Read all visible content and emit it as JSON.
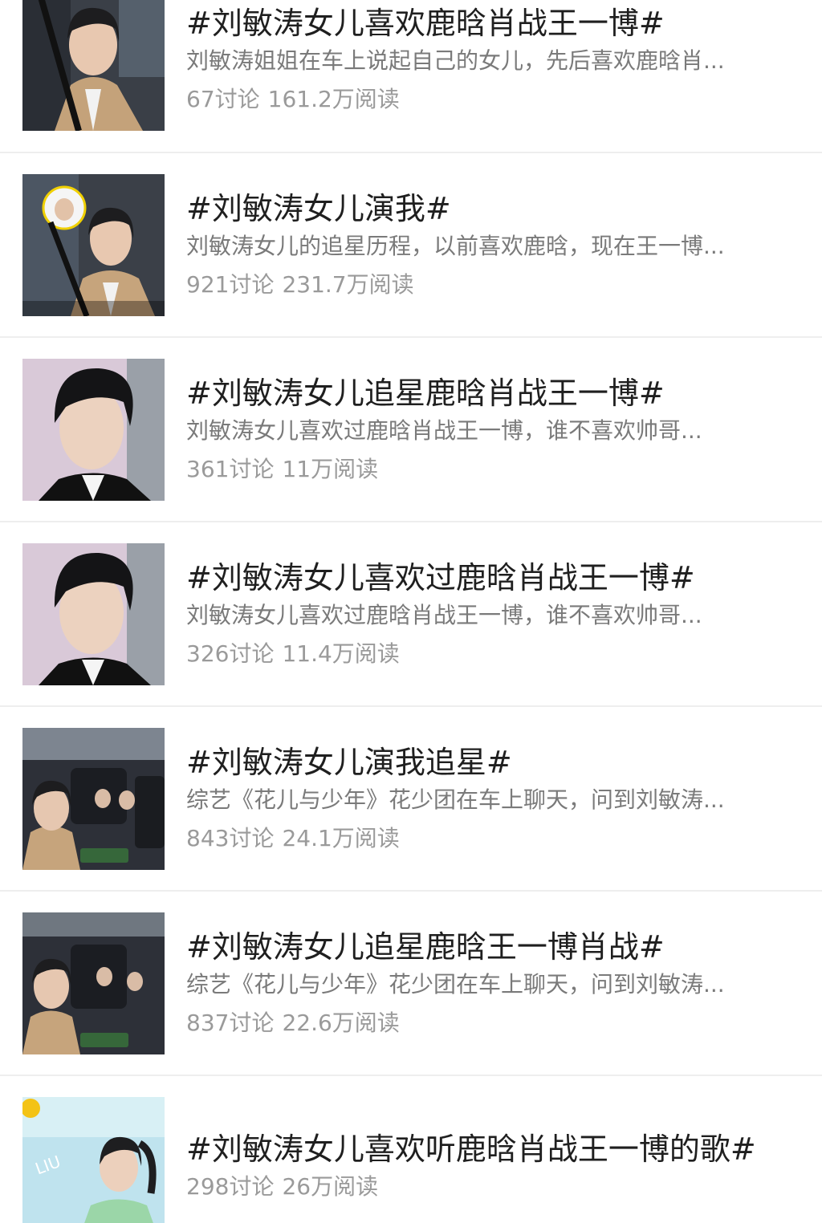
{
  "topics": [
    {
      "title": "#刘敏涛女儿喜欢鹿晗肖战王一博#",
      "description": "刘敏涛姐姐在车上说起自己的女儿，先后喜欢鹿晗肖...",
      "discussions": "67讨论",
      "reads": "161.2万阅读",
      "thumbnail_icon": "woman-in-car-thumbnail"
    },
    {
      "title": "#刘敏涛女儿演我#",
      "description": "刘敏涛女儿的追星历程，以前喜欢鹿晗，现在王一博...",
      "discussions": "921讨论",
      "reads": "231.7万阅读",
      "thumbnail_icon": "woman-in-car-thumbnail"
    },
    {
      "title": "#刘敏涛女儿追星鹿晗肖战王一博#",
      "description": "刘敏涛女儿喜欢过鹿晗肖战王一博，谁不喜欢帅哥...",
      "discussions": "361讨论",
      "reads": "11万阅读",
      "thumbnail_icon": "man-portrait-thumbnail"
    },
    {
      "title": "#刘敏涛女儿喜欢过鹿晗肖战王一博#",
      "description": "刘敏涛女儿喜欢过鹿晗肖战王一博，谁不喜欢帅哥...",
      "discussions": "326讨论",
      "reads": "11.4万阅读",
      "thumbnail_icon": "man-portrait-thumbnail"
    },
    {
      "title": "#刘敏涛女儿演我追星#",
      "description": "综艺《花儿与少年》花少团在车上聊天，问到刘敏涛...",
      "discussions": "843讨论",
      "reads": "24.1万阅读",
      "thumbnail_icon": "group-in-car-thumbnail"
    },
    {
      "title": "#刘敏涛女儿追星鹿晗王一博肖战#",
      "description": "综艺《花儿与少年》花少团在车上聊天，问到刘敏涛...",
      "discussions": "837讨论",
      "reads": "22.6万阅读",
      "thumbnail_icon": "group-in-car-thumbnail"
    },
    {
      "title": "#刘敏涛女儿喜欢听鹿晗肖战王一博的歌#",
      "description": "",
      "discussions": "298讨论",
      "reads": "26万阅读",
      "thumbnail_icon": "woman-green-sweater-thumbnail"
    }
  ]
}
